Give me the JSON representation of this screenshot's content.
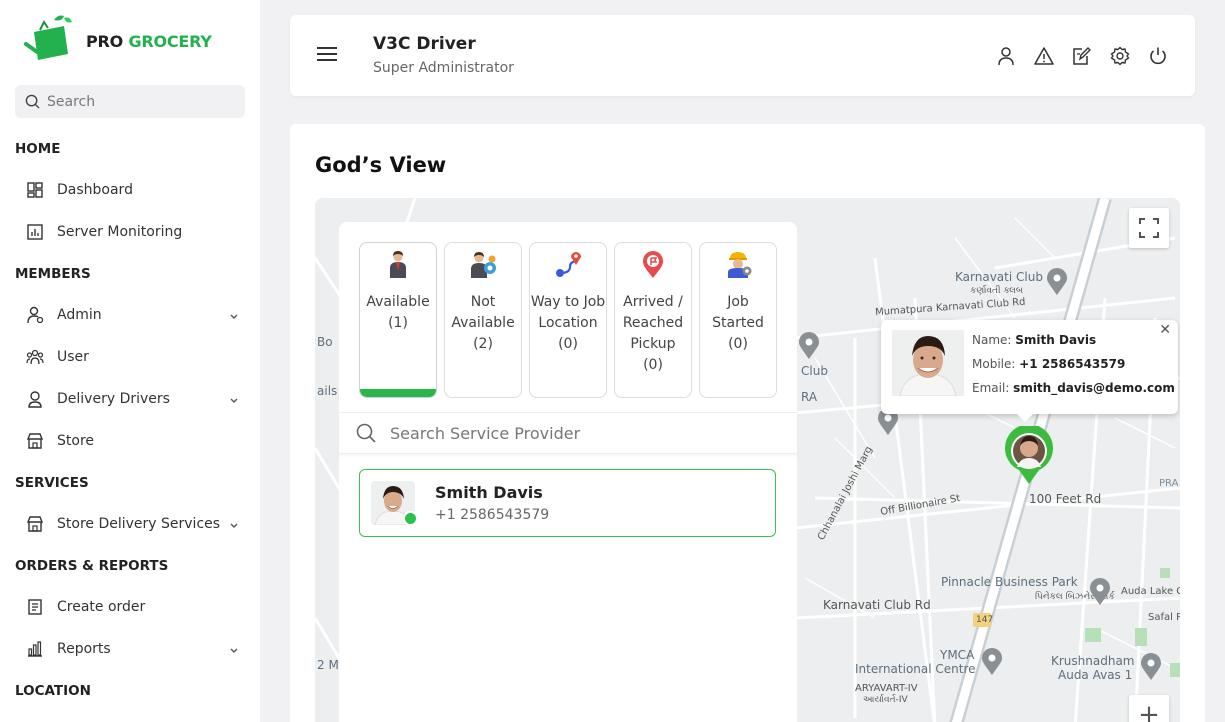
{
  "brand": {
    "pro": "PRO",
    "grocery": "GROCERY",
    "green": "#22b14c"
  },
  "sidebar": {
    "search_placeholder": "Search",
    "sections": {
      "home": "HOME",
      "members": "MEMBERS",
      "services": "SERVICES",
      "orders": "ORDERS & REPORTS",
      "location": "LOCATION"
    },
    "items": [
      {
        "label": "Dashboard",
        "icon": "dashboard-icon"
      },
      {
        "label": "Server Monitoring",
        "icon": "chart-icon"
      },
      {
        "label": "Admin",
        "icon": "admin-icon",
        "expandable": true
      },
      {
        "label": "User",
        "icon": "users-icon"
      },
      {
        "label": "Delivery Drivers",
        "icon": "driver-icon",
        "expandable": true
      },
      {
        "label": "Store",
        "icon": "store-icon"
      },
      {
        "label": "Store Delivery Services",
        "icon": "store-icon",
        "expandable": true
      },
      {
        "label": "Create order",
        "icon": "document-icon"
      },
      {
        "label": "Reports",
        "icon": "bar-chart-icon",
        "expandable": true
      }
    ]
  },
  "header": {
    "title": "V3C Driver",
    "subtitle": "Super Administrator",
    "icons": [
      "user-icon",
      "alert-icon",
      "edit-icon",
      "settings-icon",
      "power-icon"
    ]
  },
  "page": {
    "title": "God’s View"
  },
  "statuses": [
    {
      "label": "Available",
      "count": "(1)",
      "active": true
    },
    {
      "label": "Not Available",
      "count": "(2)",
      "active": false
    },
    {
      "label": "Way to Job Location",
      "count": "(0)",
      "active": false
    },
    {
      "label": "Arrived / Reached Pickup",
      "count": "(0)",
      "active": false
    },
    {
      "label": "Job Started",
      "count": "(0)",
      "active": false
    }
  ],
  "provider_search": {
    "placeholder": "Search Service Provider"
  },
  "drivers": [
    {
      "name": "Smith Davis",
      "phone": "+1 2586543579",
      "online": true
    }
  ],
  "popup": {
    "name_label": "Name:",
    "name": "Smith Davis",
    "mobile_label": "Mobile:",
    "mobile": "+1 2586543579",
    "email_label": "Email:",
    "email": "smith_davis@demo.com"
  },
  "map_labels": {
    "karnavati_club": "Karnavati Club",
    "karnavati_club_guj": "કર્ણાવતી ક્લબ",
    "mumatpura": "Mumatpura Karnavati Club Rd",
    "club": "Club",
    "ra": "RA",
    "bo": "Bo",
    "ails": "ails",
    "hundred_feet": "100 Feet Rd",
    "off_billionaire": "Off Billionaire St",
    "chanalai": "Chhanalai Joshi Marg",
    "pinnacle": "Pinnacle Business Park",
    "pinnacle_guj": "પિનેકલ બિઝનેસ પાર્ક",
    "karnavati_rd": "Karnavati Club Rd",
    "auda_lake": "Auda Lake Ga",
    "safal": "Safal R",
    "ymca": "YMCA",
    "intl_centre": "International Centre",
    "aryavart": "ARYAVART-IV",
    "aryavart_guj": "આર્યાવર્ત-IV",
    "krushnadham": "Krushnadham",
    "auda_avas": "Auda Avas 1",
    "two_m": "2 M",
    "pra": "PRA",
    "route147": "147"
  }
}
